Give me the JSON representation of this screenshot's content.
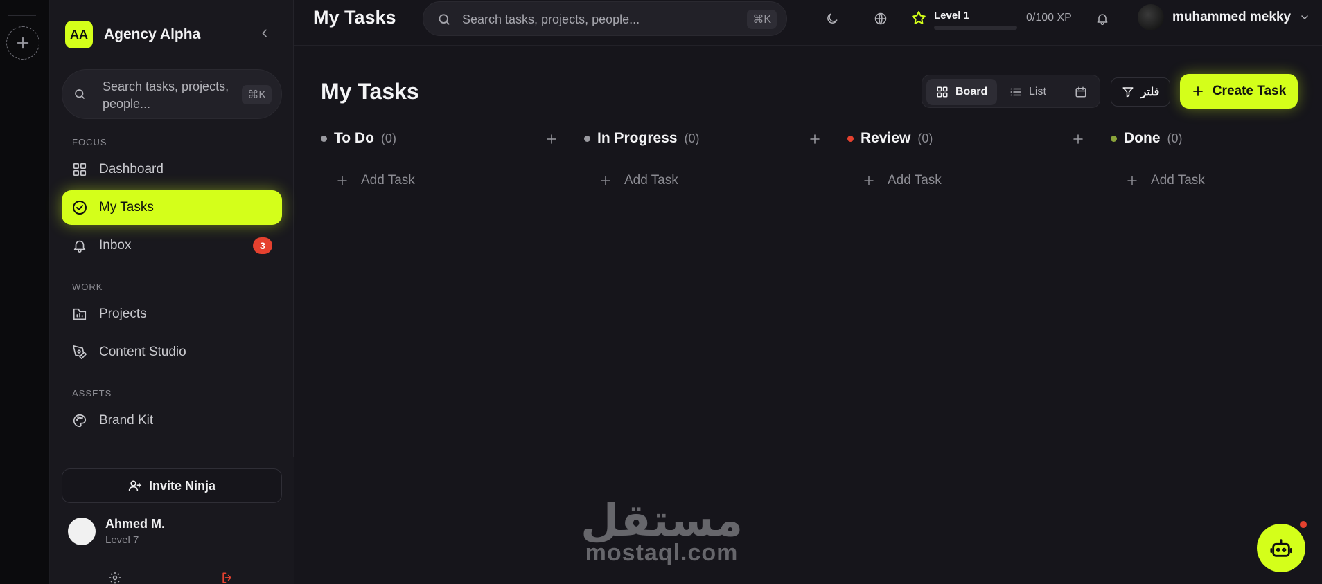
{
  "colors": {
    "accent": "#d4ff1a",
    "badge": "#e5412f",
    "background": "#16151b",
    "sidebar": "#19181e"
  },
  "sidebar": {
    "brand_initials": "AA",
    "brand_name": "Agency Alpha",
    "search_placeholder": "Search tasks, projects, people...",
    "search_shortcut": "⌘K",
    "sections": [
      {
        "label": "FOCUS",
        "items": [
          {
            "label": "Dashboard",
            "icon": "grid-icon"
          },
          {
            "label": "My Tasks",
            "icon": "check-circle-icon",
            "active": true
          },
          {
            "label": "Inbox",
            "icon": "bell-icon",
            "badge": "3"
          }
        ]
      },
      {
        "label": "WORK",
        "items": [
          {
            "label": "Projects",
            "icon": "chart-folder-icon"
          },
          {
            "label": "Content Studio",
            "icon": "pen-tool-icon"
          }
        ]
      },
      {
        "label": "ASSETS",
        "items": [
          {
            "label": "Brand Kit",
            "icon": "palette-icon"
          }
        ]
      }
    ],
    "invite_label": "Invite Ninja",
    "user": {
      "name": "Ahmed M.",
      "level": "Level 7"
    }
  },
  "topbar": {
    "title": "My Tasks",
    "search_placeholder": "Search tasks, projects, people...",
    "search_shortcut": "⌘K",
    "level_label": "Level 1",
    "level_progress": 0,
    "xp": "0/100 XP",
    "profile_name": "muhammed mekky"
  },
  "main": {
    "title": "My Tasks",
    "views": [
      {
        "label": "Board",
        "icon": "grid-icon",
        "active": true
      },
      {
        "label": "List",
        "icon": "list-icon"
      },
      {
        "label": "",
        "icon": "calendar-icon"
      }
    ],
    "filter_label": "فلتر",
    "create_label": "Create Task",
    "columns": [
      {
        "name": "To Do",
        "count": "(0)",
        "dot": "#9a9aa0",
        "add_label": "Add Task"
      },
      {
        "name": "In Progress",
        "count": "(0)",
        "dot": "#9a9aa0",
        "add_label": "Add Task"
      },
      {
        "name": "Review",
        "count": "(0)",
        "dot": "#e5412f",
        "add_label": "Add Task"
      },
      {
        "name": "Done",
        "count": "(0)",
        "dot": "#8aa33a",
        "add_label": "Add Task"
      }
    ]
  },
  "watermark": {
    "arabic": "مستقل",
    "latin": "mostaql.com"
  }
}
